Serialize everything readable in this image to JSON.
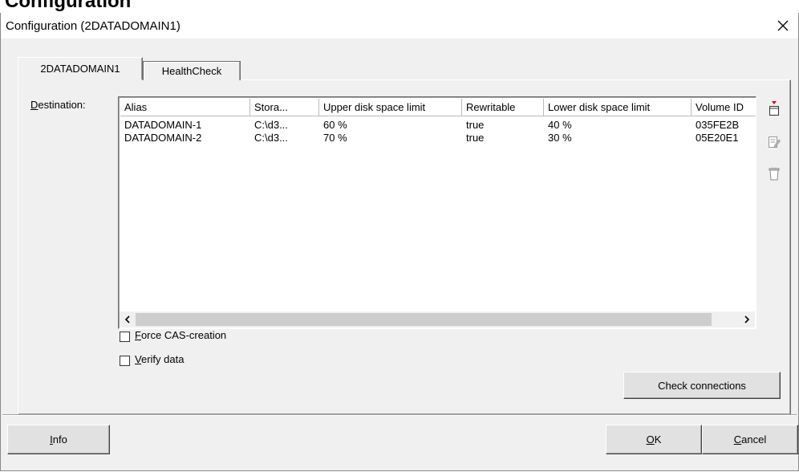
{
  "top_strip_text": "Configuration",
  "window": {
    "title": "Configuration (2DATADOMAIN1)",
    "close_glyph": "✕"
  },
  "tabs": [
    {
      "label": "2DATADOMAIN1",
      "active": true
    },
    {
      "label": "HealthCheck",
      "active": false
    }
  ],
  "destination": {
    "label_accel": "D",
    "label_rest": "estination:"
  },
  "table": {
    "columns": [
      "Alias",
      "Stora...",
      "Upper disk space limit",
      "Rewritable",
      "Lower disk space limit",
      "Volume ID"
    ],
    "rows": [
      [
        "DATADOMAIN-1",
        "C:\\d3...",
        "60 %",
        "true",
        "40 %",
        "035FE2B"
      ],
      [
        "DATADOMAIN-2",
        "C:\\d3...",
        "70 %",
        "true",
        "30 %",
        "05E20E1"
      ]
    ]
  },
  "scrollbar": {
    "left_glyph": "‹",
    "right_glyph": "›"
  },
  "side_icons": [
    "add-icon",
    "edit-icon",
    "delete-icon"
  ],
  "options": {
    "force_cas": {
      "accel": "F",
      "rest": "orce CAS-creation",
      "checked": false
    },
    "verify": {
      "accel": "V",
      "rest": "erify data",
      "checked": false
    }
  },
  "buttons": {
    "check_connections": "Check connections",
    "info_accel": "I",
    "info_rest": "nfo",
    "ok_accel": "O",
    "ok_rest": "K",
    "cancel_accel": "C",
    "cancel_rest": "ancel"
  },
  "colors": {
    "dialog_bg": "#f0f0f0",
    "accent_red": "#d01010"
  }
}
